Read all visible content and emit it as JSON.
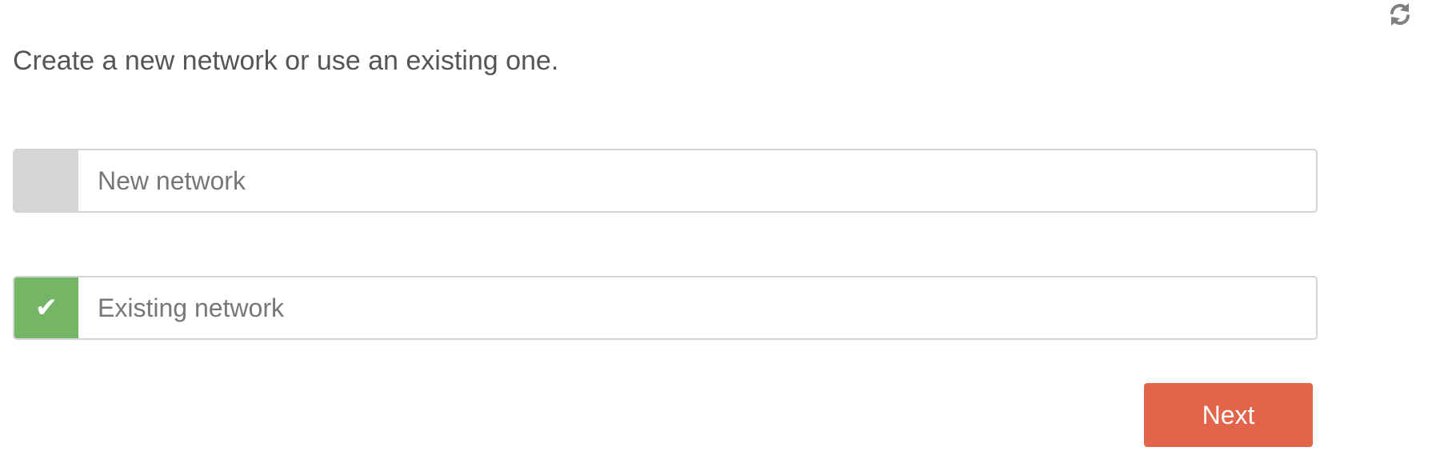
{
  "header": {
    "refresh_icon": "refresh-icon"
  },
  "prompt": {
    "text": "Create a new network or use an existing one."
  },
  "options": [
    {
      "label": "New network",
      "selected": false,
      "check_glyph": ""
    },
    {
      "label": "Existing network",
      "selected": true,
      "check_glyph": "✔"
    }
  ],
  "actions": {
    "next_label": "Next"
  },
  "colors": {
    "selected_check": "#74b566",
    "unselected_check": "#d5d6d7",
    "next_button": "#e2644a",
    "text": "#555555",
    "option_text": "#777777",
    "border": "#d4d4d4"
  }
}
